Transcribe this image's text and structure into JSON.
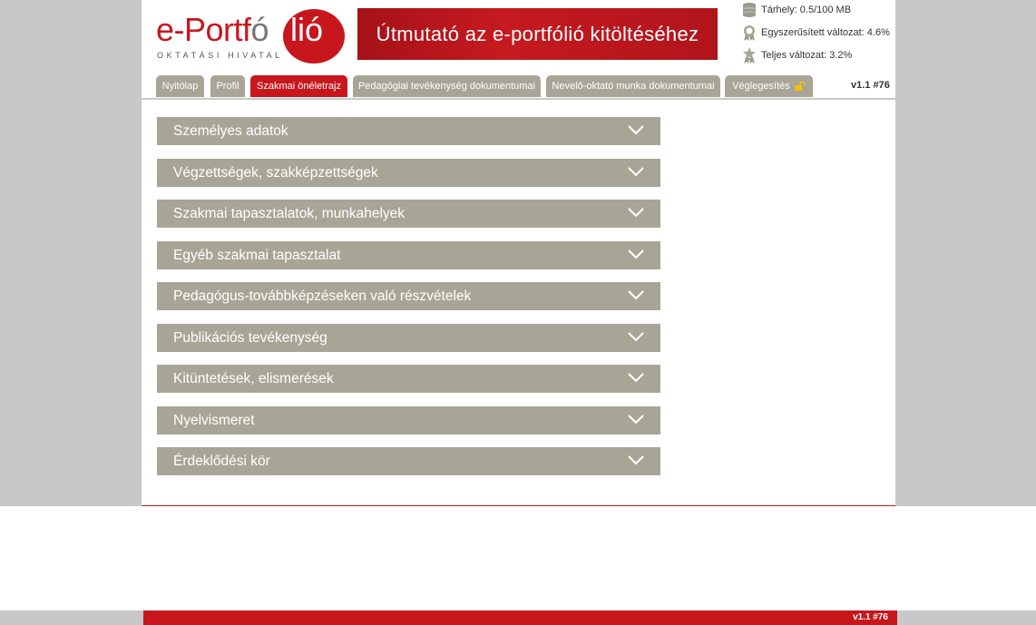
{
  "header": {
    "logo_prefix": "e-Portf",
    "logo_suffix": "lió",
    "logo_o": "ó",
    "logo_subtitle": "OKTATÁSI HIVATAL",
    "banner_text": "Útmutató az e-portfólió kitöltéséhez",
    "stats": [
      {
        "icon": "database-icon",
        "text": "Tárhely: 0.5/100 MB"
      },
      {
        "icon": "badge-icon",
        "text": "Egyszerűsített változat: 4.6%"
      },
      {
        "icon": "star-badge-icon",
        "text": "Teljes változat: 3.2%"
      }
    ],
    "version": "v1.1 #76"
  },
  "tabs": [
    {
      "label": "Nyitólap"
    },
    {
      "label": "Profil"
    },
    {
      "label": "Szakmai önéletrajz"
    },
    {
      "label": "Pedagógiai tevékenység dokumentumai"
    },
    {
      "label": "Nevelő-oktató munka dokumentumai"
    },
    {
      "label": "Véglegesítés"
    }
  ],
  "sections": [
    {
      "label": "Személyes adatok"
    },
    {
      "label": "Végzettségek, szakképzettségek"
    },
    {
      "label": "Szakmai tapasztalatok, munkahelyek"
    },
    {
      "label": "Egyéb szakmai tapasztalat"
    },
    {
      "label": "Pedagógus-továbbképzéseken való részvételek"
    },
    {
      "label": "Publikációs tevékenység"
    },
    {
      "label": "Kitüntetések, elismerések"
    },
    {
      "label": "Nyelvismeret"
    },
    {
      "label": "Érdeklődési kör"
    }
  ],
  "footer": {
    "version": "v1.1 #76"
  },
  "colors": {
    "brand_red": "#c8161d",
    "tab_gray": "#a9a596"
  }
}
